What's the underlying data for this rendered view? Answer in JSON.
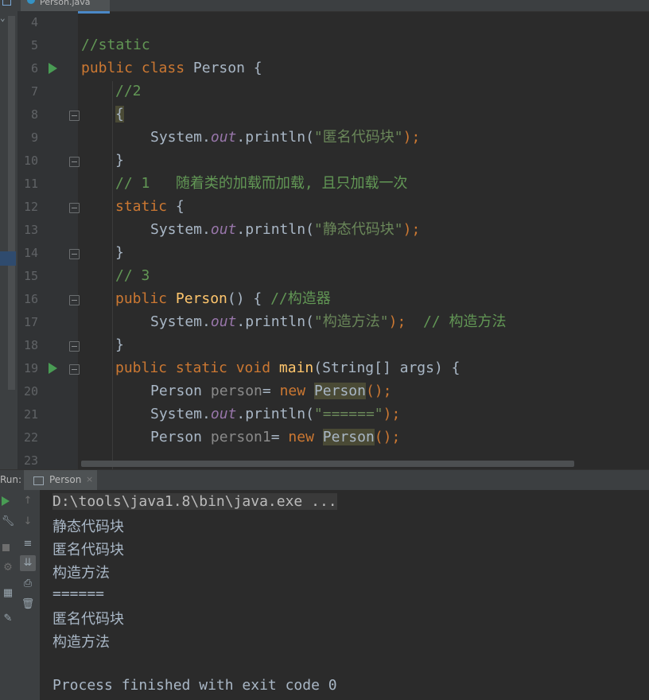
{
  "editor": {
    "tab_label": "Person.java",
    "line_numbers": [
      "4",
      "5",
      "6",
      "7",
      "8",
      "9",
      "10",
      "11",
      "12",
      "13",
      "14",
      "15",
      "16",
      "17",
      "18",
      "19",
      "20",
      "21",
      "22",
      "23"
    ],
    "lines": {
      "l5": [
        "//static"
      ],
      "l6": [
        "public",
        " class ",
        "Person {"
      ],
      "l7": [
        "//2"
      ],
      "l8": [
        "{"
      ],
      "l9": [
        "System.",
        "out",
        ".println(",
        "\"匿名代码块\"",
        ");"
      ],
      "l10": [
        "}"
      ],
      "l11": [
        "// 1   随着类的加载而加载, 且只加载一次"
      ],
      "l12": [
        "static",
        " {"
      ],
      "l13": [
        "System.",
        "out",
        ".println(",
        "\"静态代码块\"",
        ");"
      ],
      "l14": [
        "}"
      ],
      "l15": [
        "// 3"
      ],
      "l16": [
        "public ",
        "Person",
        "() { ",
        "//构造器"
      ],
      "l17": [
        "System.",
        "out",
        ".println(",
        "\"构造方法\"",
        ");  ",
        "// 构造方法"
      ],
      "l18": [
        "}"
      ],
      "l19": [
        "public static void ",
        "main",
        "(String[] args) {"
      ],
      "l20": [
        "Person ",
        "person",
        "= ",
        "new ",
        "Person",
        "();"
      ],
      "l21": [
        "System.",
        "out",
        ".println(",
        "\"======\"",
        ");"
      ],
      "l22": [
        "Person ",
        "person1",
        "= ",
        "new ",
        "Person",
        "();"
      ]
    }
  },
  "run": {
    "label": "Run:",
    "tab_label": "Person",
    "close_glyph": "×",
    "output": [
      "D:\\tools\\java1.8\\bin\\java.exe ...",
      "静态代码块",
      "匿名代码块",
      "构造方法",
      "======",
      "匿名代码块",
      "构造方法",
      "",
      "Process finished with exit code 0"
    ]
  }
}
